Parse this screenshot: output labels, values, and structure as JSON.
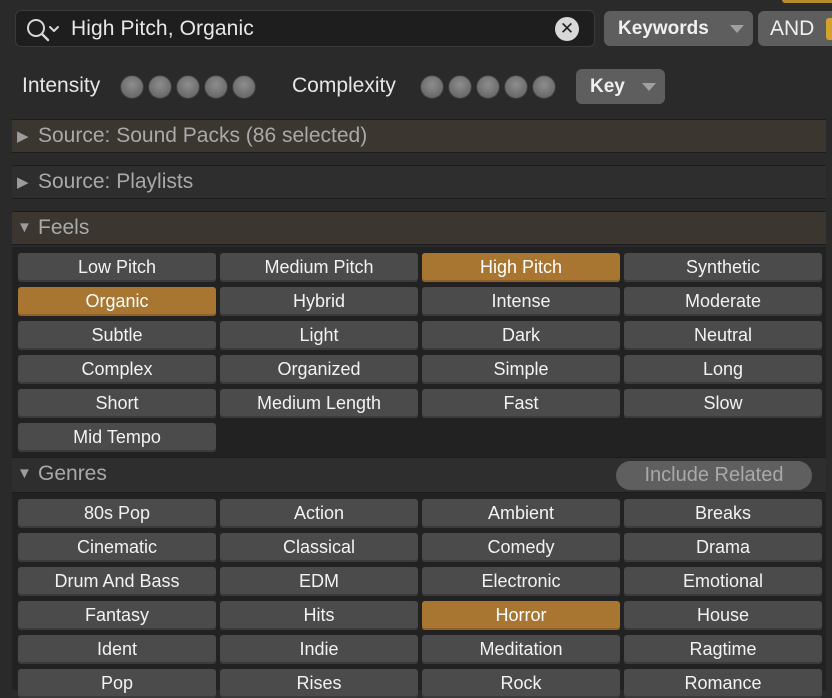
{
  "search": {
    "query": "High Pitch, Organic",
    "clear_symbol": "✕",
    "mode": "Keywords",
    "operator": "AND"
  },
  "filters": {
    "intensity_label": "Intensity",
    "complexity_label": "Complexity",
    "key_label": "Key"
  },
  "sections": {
    "sound_packs": {
      "arrow": "▶",
      "title": "Source: Sound Packs (86 selected)"
    },
    "playlists": {
      "arrow": "▶",
      "title": "Source: Playlists"
    },
    "feels": {
      "arrow": "▼",
      "title": "Feels"
    },
    "genres": {
      "arrow": "▼",
      "title": "Genres",
      "include_related": "Include Related"
    }
  },
  "feels_tags": [
    {
      "label": "Low Pitch",
      "selected": false
    },
    {
      "label": "Medium Pitch",
      "selected": false
    },
    {
      "label": "High Pitch",
      "selected": true
    },
    {
      "label": "Synthetic",
      "selected": false
    },
    {
      "label": "Organic",
      "selected": true
    },
    {
      "label": "Hybrid",
      "selected": false
    },
    {
      "label": "Intense",
      "selected": false
    },
    {
      "label": "Moderate",
      "selected": false
    },
    {
      "label": "Subtle",
      "selected": false
    },
    {
      "label": "Light",
      "selected": false
    },
    {
      "label": "Dark",
      "selected": false
    },
    {
      "label": "Neutral",
      "selected": false
    },
    {
      "label": "Complex",
      "selected": false
    },
    {
      "label": "Organized",
      "selected": false
    },
    {
      "label": "Simple",
      "selected": false
    },
    {
      "label": "Long",
      "selected": false
    },
    {
      "label": "Short",
      "selected": false
    },
    {
      "label": "Medium Length",
      "selected": false
    },
    {
      "label": "Fast",
      "selected": false
    },
    {
      "label": "Slow",
      "selected": false
    },
    {
      "label": "Mid Tempo",
      "selected": false
    }
  ],
  "genre_tags": [
    {
      "label": "80s Pop",
      "selected": false
    },
    {
      "label": "Action",
      "selected": false
    },
    {
      "label": "Ambient",
      "selected": false
    },
    {
      "label": "Breaks",
      "selected": false
    },
    {
      "label": "Cinematic",
      "selected": false
    },
    {
      "label": "Classical",
      "selected": false
    },
    {
      "label": "Comedy",
      "selected": false
    },
    {
      "label": "Drama",
      "selected": false
    },
    {
      "label": "Drum And Bass",
      "selected": false
    },
    {
      "label": "EDM",
      "selected": false
    },
    {
      "label": "Electronic",
      "selected": false
    },
    {
      "label": "Emotional",
      "selected": false
    },
    {
      "label": "Fantasy",
      "selected": false
    },
    {
      "label": "Hits",
      "selected": false
    },
    {
      "label": "Horror",
      "selected": true
    },
    {
      "label": "House",
      "selected": false
    },
    {
      "label": "Ident",
      "selected": false
    },
    {
      "label": "Indie",
      "selected": false
    },
    {
      "label": "Meditation",
      "selected": false
    },
    {
      "label": "Ragtime",
      "selected": false
    },
    {
      "label": "Pop",
      "selected": false
    },
    {
      "label": "Rises",
      "selected": false
    },
    {
      "label": "Rock",
      "selected": false
    },
    {
      "label": "Romance",
      "selected": false
    }
  ],
  "colors": {
    "accent": "#a97632",
    "tag_bg": "#4b4b4b",
    "panel_bg": "#222222"
  }
}
